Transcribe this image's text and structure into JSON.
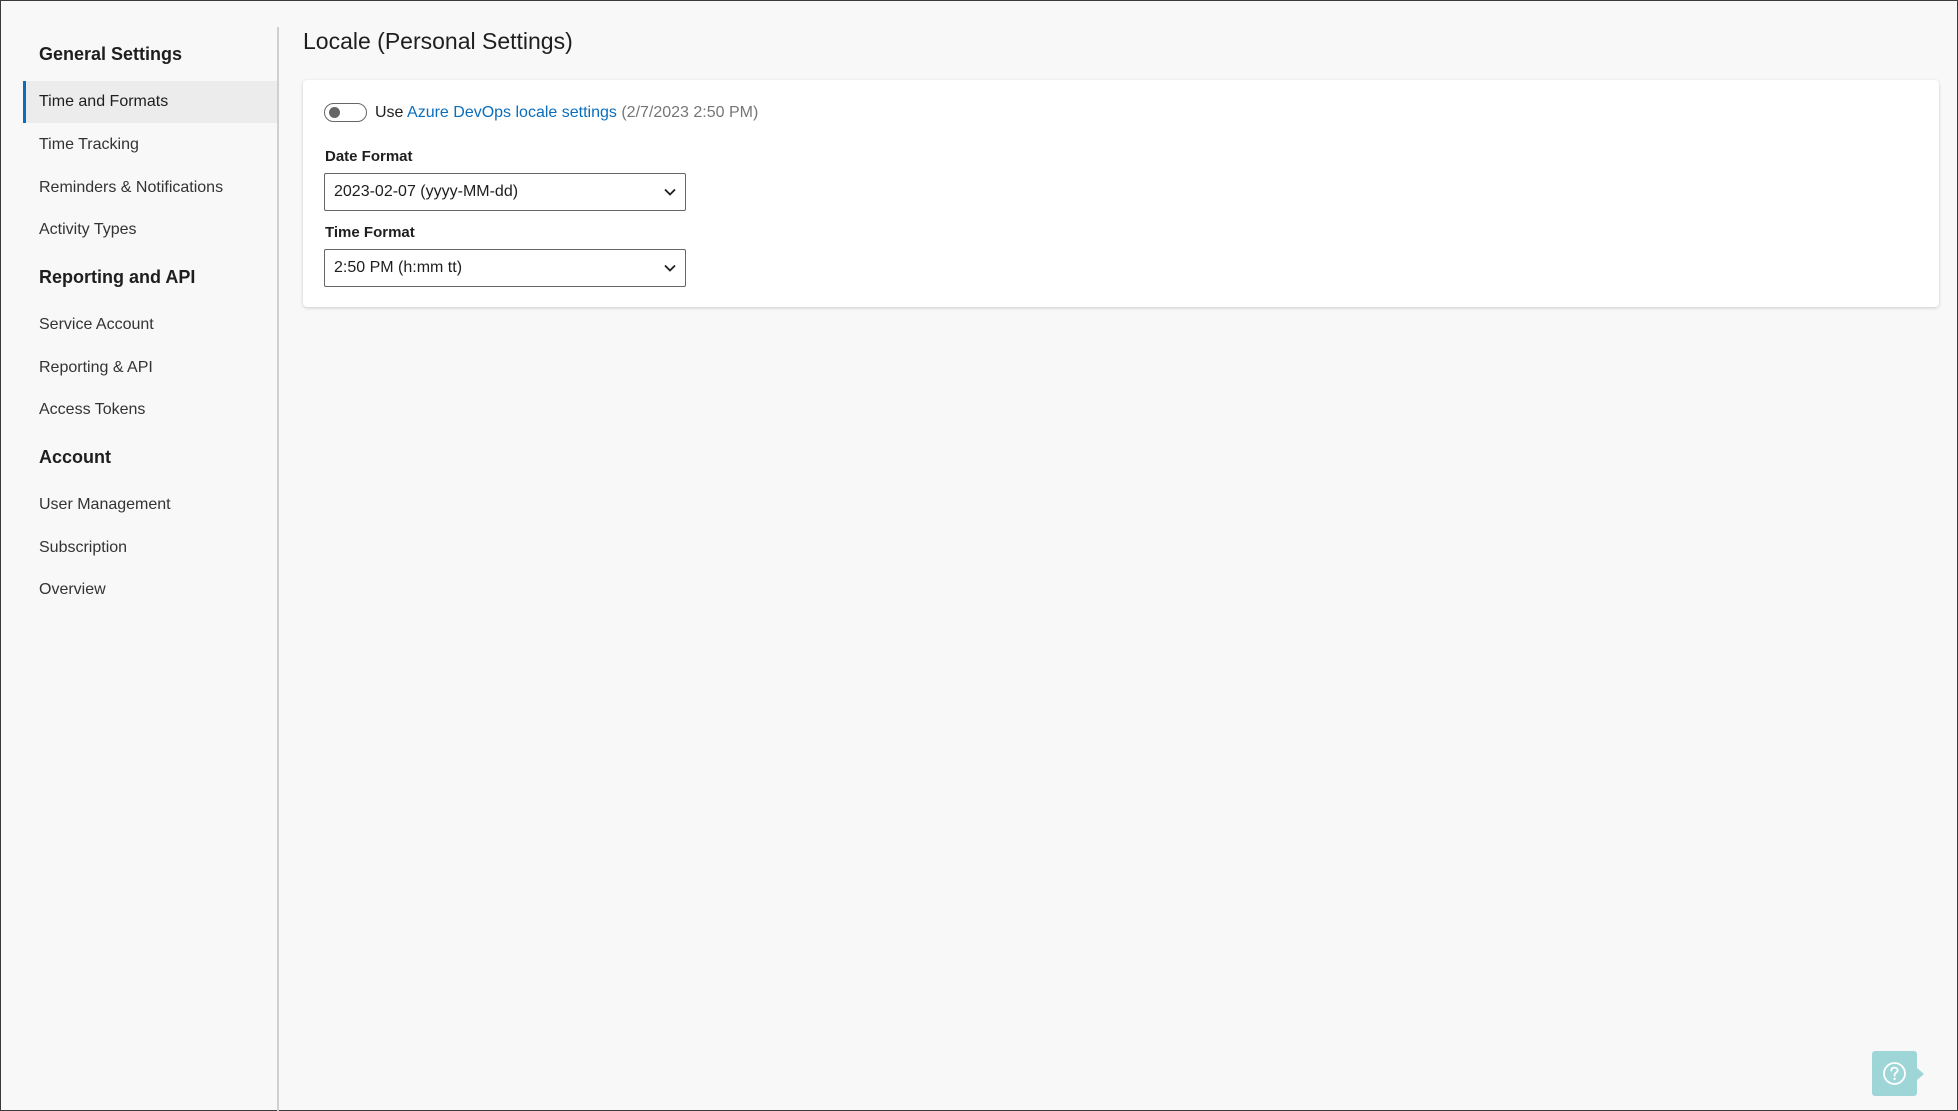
{
  "sidebar": {
    "sections": [
      {
        "title": "General Settings",
        "items": [
          "Time and Formats",
          "Time Tracking",
          "Reminders & Notifications",
          "Activity Types"
        ]
      },
      {
        "title": "Reporting and API",
        "items": [
          "Service Account",
          "Reporting & API",
          "Access Tokens"
        ]
      },
      {
        "title": "Account",
        "items": [
          "User Management",
          "Subscription",
          "Overview"
        ]
      }
    ],
    "selected_item": "Time and Formats"
  },
  "main": {
    "title": "Locale (Personal Settings)",
    "toggle": {
      "checked": false,
      "prefix": "Use",
      "link_text": "Azure DevOps locale settings",
      "suffix": "(2/7/2023 2:50 PM)"
    },
    "date_format": {
      "label": "Date Format",
      "value": "2023-02-07 (yyyy-MM-dd)"
    },
    "time_format": {
      "label": "Time Format",
      "value": "2:50 PM (h:mm tt)"
    }
  },
  "help": {
    "icon": "question-mark-icon"
  },
  "colors": {
    "accent": "#0a6ebd",
    "help_button": "#9ed6d8",
    "background": "#f8f8f8"
  }
}
